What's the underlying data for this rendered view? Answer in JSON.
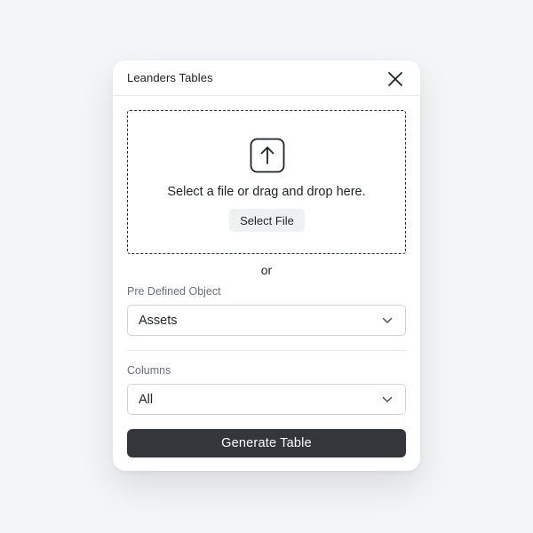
{
  "dialog": {
    "title": "Leanders Tables"
  },
  "upload": {
    "prompt": "Select a file or drag and drop here.",
    "select_file_label": "Select File",
    "or_label": "or"
  },
  "predefined_object": {
    "label": "Pre Defined Object",
    "value": "Assets"
  },
  "columns": {
    "label": "Columns",
    "value": "All"
  },
  "actions": {
    "generate_label": "Generate Table"
  },
  "icons": {
    "close": "close-icon",
    "upload": "upload-arrow-icon",
    "dropdown": "chevron-down-icon"
  },
  "colors": {
    "primary_button": "#33373c",
    "secondary_button": "#eef0f2",
    "background": "#f4f5f7"
  }
}
